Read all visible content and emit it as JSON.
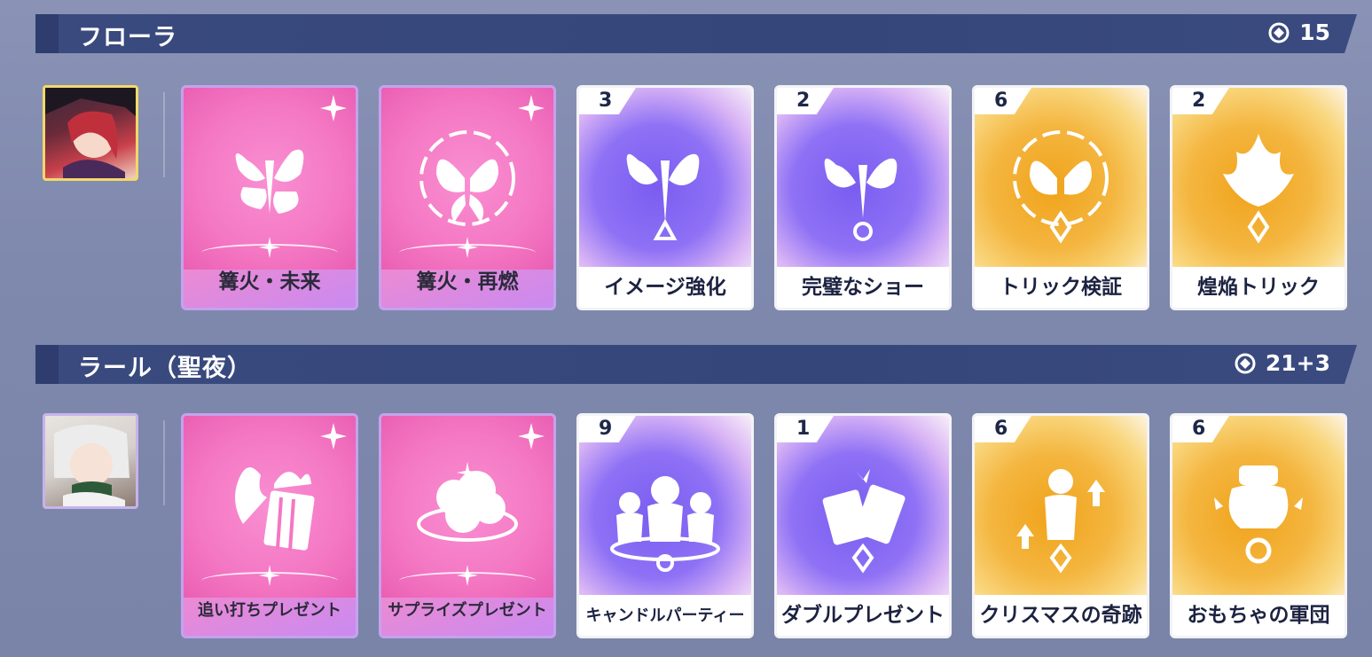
{
  "sections": [
    {
      "title": "フローラ",
      "points": "15",
      "cards": [
        {
          "name": "篝火・未来",
          "type": "pink",
          "badge": "",
          "icon": "butterfly-flower-icon"
        },
        {
          "name": "篝火・再燃",
          "type": "pink",
          "badge": "",
          "icon": "butterfly-ring-icon"
        },
        {
          "name": "イメージ強化",
          "type": "purple",
          "badge": "3",
          "icon": "butterfly-triangle-icon"
        },
        {
          "name": "完璧なショー",
          "type": "purple",
          "badge": "2",
          "icon": "butterfly-circle-icon"
        },
        {
          "name": "トリック検証",
          "type": "gold",
          "badge": "6",
          "icon": "butterfly-diamond-icon"
        },
        {
          "name": "煌焔トリック",
          "type": "gold",
          "badge": "2",
          "icon": "flame-diamond-icon"
        }
      ]
    },
    {
      "title": "ラール（聖夜）",
      "points": "21+3",
      "cards": [
        {
          "name": "追い打ちプレゼント",
          "type": "pink",
          "badge": "",
          "icon": "gift-flame-icon"
        },
        {
          "name": "サプライズプレゼント",
          "type": "pink",
          "badge": "",
          "icon": "cloud-burst-icon"
        },
        {
          "name": "キャンドルパーティー",
          "type": "purple",
          "badge": "9",
          "icon": "three-figures-icon"
        },
        {
          "name": "ダブルプレゼント",
          "type": "purple",
          "badge": "1",
          "icon": "double-gift-icon"
        },
        {
          "name": "クリスマスの奇跡",
          "type": "gold",
          "badge": "6",
          "icon": "figure-arrows-icon"
        },
        {
          "name": "おもちゃの軍団",
          "type": "gold",
          "badge": "6",
          "icon": "toy-robot-icon"
        }
      ]
    }
  ],
  "colors": {
    "pink": "#f36cbd",
    "purple": "#7a5df0",
    "gold": "#f0a31b",
    "header": "#34467a"
  }
}
